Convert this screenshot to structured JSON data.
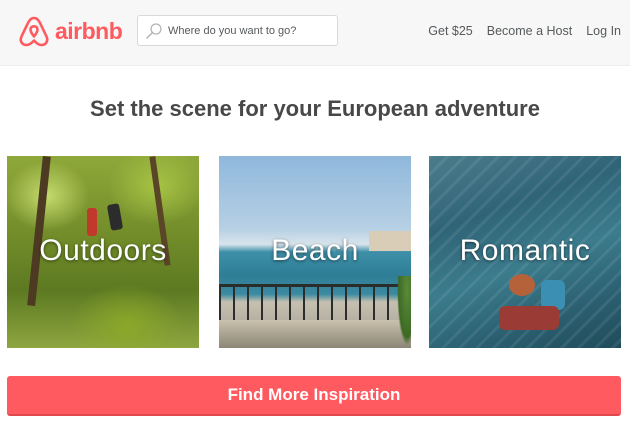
{
  "brand": {
    "name": "airbnb",
    "color": "#ff5a5f"
  },
  "search": {
    "placeholder": "Where do you want to go?",
    "icon": "search-icon"
  },
  "nav": {
    "items": [
      {
        "label": "Get $25"
      },
      {
        "label": "Become a Host"
      },
      {
        "label": "Log In"
      }
    ]
  },
  "main": {
    "headline": "Set the scene for your European adventure",
    "tiles": [
      {
        "label": "Outdoors"
      },
      {
        "label": "Beach"
      },
      {
        "label": "Romantic"
      }
    ],
    "cta_label": "Find More Inspiration"
  }
}
